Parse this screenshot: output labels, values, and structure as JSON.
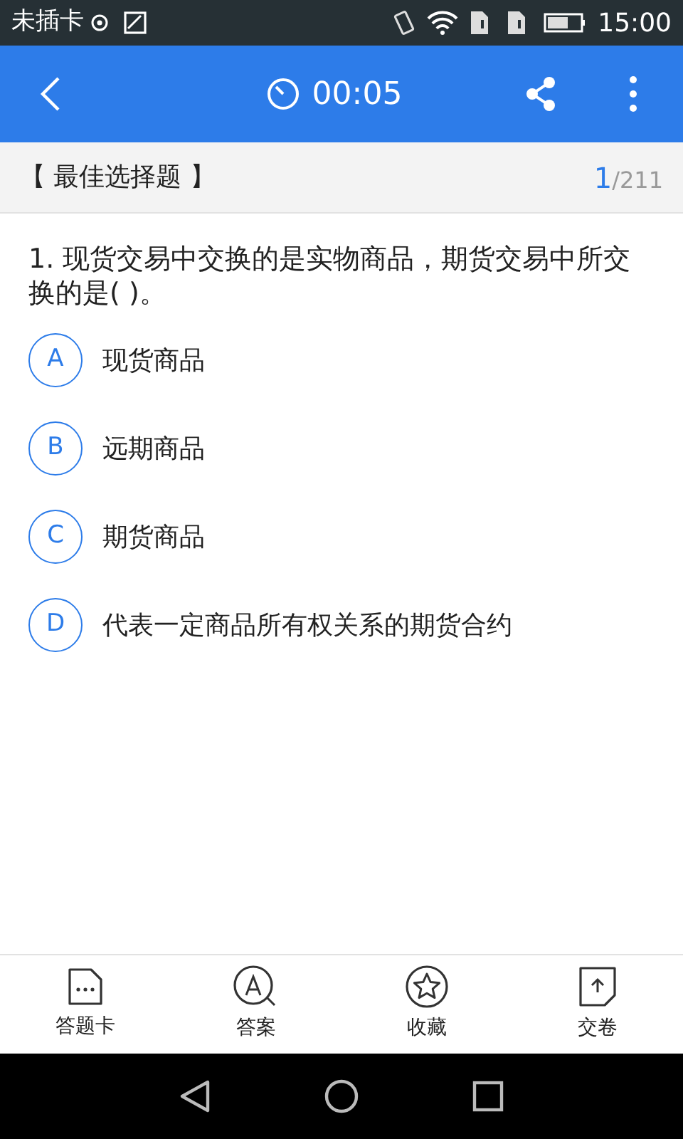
{
  "status_bar": {
    "carrier": "未插卡",
    "time": "15:00"
  },
  "app_bar": {
    "timer": "00:05"
  },
  "section": {
    "title": "【 最佳选择题 】",
    "current": "1",
    "total": "/211"
  },
  "question": {
    "text": "1. 现货交易中交换的是实物商品，期货交易中所交换的是(   )。",
    "options": [
      {
        "letter": "A",
        "text": "现货商品",
        "selected": false
      },
      {
        "letter": "B",
        "text": "远期商品",
        "selected": false
      },
      {
        "letter": "C",
        "text": "期货商品",
        "selected": false
      },
      {
        "letter": "D",
        "text": "代表一定商品所有权关系的期货合约",
        "selected": false
      }
    ]
  },
  "bottom_bar": [
    {
      "kind": "card",
      "label": "答题卡"
    },
    {
      "kind": "answer",
      "label": "答案"
    },
    {
      "kind": "favorite",
      "label": "收藏"
    },
    {
      "kind": "submit",
      "label": "交卷"
    }
  ]
}
